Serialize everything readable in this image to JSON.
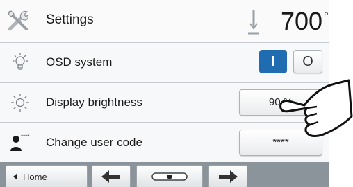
{
  "header": {
    "title": "Settings",
    "temperature": "700",
    "unit": "°C",
    "icon": "tools-icon"
  },
  "rows": [
    {
      "label": "OSD system",
      "icon": "lightbulb-icon",
      "toggle_on": "I",
      "toggle_off": "O"
    },
    {
      "label": "Display brightness",
      "icon": "sun-icon",
      "value": "90 %"
    },
    {
      "label": "Change user code",
      "icon": "user-code-icon",
      "value": "****"
    }
  ],
  "footer": {
    "home_label": "Home",
    "buttons": [
      "arrow-left-icon",
      "slider-icon",
      "arrow-right-icon"
    ]
  },
  "colors": {
    "accent": "#1f6cb1",
    "footer": "#8c949b"
  }
}
